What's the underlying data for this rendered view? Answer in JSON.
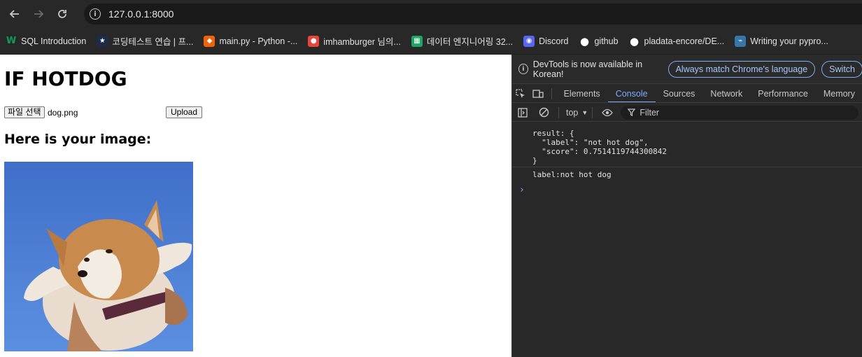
{
  "browser": {
    "url": "127.0.0.1:8000",
    "bookmarks": [
      {
        "label": "SQL Introduction",
        "icon": "w-icon",
        "color": "#0f9d58"
      },
      {
        "label": "코딩테스트 연습 | 프...",
        "icon": "star-icon",
        "color": "#1e2a4a"
      },
      {
        "label": "main.py - Python -...",
        "icon": "replit-icon",
        "color": "#f26207"
      },
      {
        "label": "imhamburger 님의...",
        "icon": "velog-icon",
        "color": "#e8453c"
      },
      {
        "label": "데이터 엔지니어링 32...",
        "icon": "sheets-icon",
        "color": "#1fa463"
      },
      {
        "label": "Discord",
        "icon": "discord-icon",
        "color": "#5865f2"
      },
      {
        "label": "github",
        "icon": "github-icon",
        "color": "#ffffff"
      },
      {
        "label": "pladata-encore/DE...",
        "icon": "github-icon",
        "color": "#ffffff"
      },
      {
        "label": "Writing your pypro...",
        "icon": "python-icon",
        "color": "#3776ab"
      }
    ]
  },
  "page": {
    "title": "IF HOTDOG",
    "file_button": "파일 선택",
    "file_name": "dog.png",
    "upload_button": "Upload",
    "subtitle": "Here is your image:"
  },
  "devtools": {
    "banner_msg": "DevTools is now available in Korean!",
    "banner_btn1": "Always match Chrome's language",
    "banner_btn2": "Switch",
    "tabs": [
      "Elements",
      "Console",
      "Sources",
      "Network",
      "Performance",
      "Memory"
    ],
    "active_tab": "Console",
    "context": "top",
    "filter_placeholder": "Filter",
    "log1": "result: {\n  \"label\": \"not hot dog\",\n  \"score\": 0.7514119744300842\n}",
    "log2": "label:not hot dog",
    "prompt": "›"
  }
}
